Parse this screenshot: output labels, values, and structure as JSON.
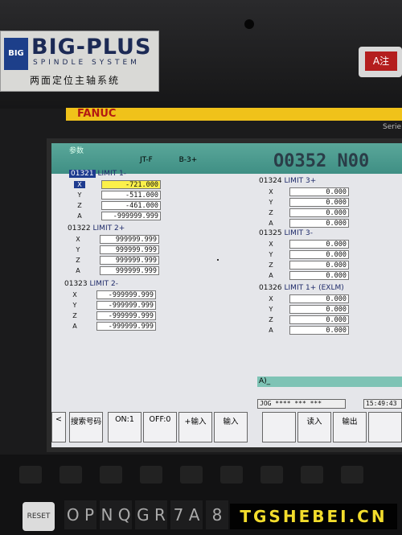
{
  "bezel": {
    "brand_title": "BIG-PLUS",
    "brand_subtitle": "SPINDLE SYSTEM",
    "brand_chinese": "两面定位主轴系统",
    "cnc_brand": "FANUC",
    "series_label": "Serie",
    "warning_label": "A注"
  },
  "screen": {
    "header_label": "参数",
    "program_label": "JT-F",
    "program_suffix": "B-3+",
    "program_number": "O0352 N00",
    "params_left": [
      {
        "id": "01321",
        "name": "LIMIT 1-",
        "rows": [
          {
            "axis": "X",
            "value": "-721.000"
          },
          {
            "axis": "Y",
            "value": "-511.000"
          },
          {
            "axis": "Z",
            "value": "-461.000"
          },
          {
            "axis": "A",
            "value": "-999999.999"
          }
        ]
      },
      {
        "id": "01322",
        "name": "LIMIT 2+",
        "rows": [
          {
            "axis": "X",
            "value": "999999.999"
          },
          {
            "axis": "Y",
            "value": "999999.999"
          },
          {
            "axis": "Z",
            "value": "999999.999"
          },
          {
            "axis": "A",
            "value": "999999.999"
          }
        ]
      },
      {
        "id": "01323",
        "name": "LIMIT 2-",
        "rows": [
          {
            "axis": "X",
            "value": "-999999.999"
          },
          {
            "axis": "Y",
            "value": "-999999.999"
          },
          {
            "axis": "Z",
            "value": "-999999.999"
          },
          {
            "axis": "A",
            "value": "-999999.999"
          }
        ]
      }
    ],
    "params_right": [
      {
        "id": "01324",
        "name": "LIMIT 3+",
        "rows": [
          {
            "axis": "X",
            "value": "0.000"
          },
          {
            "axis": "Y",
            "value": "0.000"
          },
          {
            "axis": "Z",
            "value": "0.000"
          },
          {
            "axis": "A",
            "value": "0.000"
          }
        ]
      },
      {
        "id": "01325",
        "name": "LIMIT 3-",
        "rows": [
          {
            "axis": "X",
            "value": "0.000"
          },
          {
            "axis": "Y",
            "value": "0.000"
          },
          {
            "axis": "Z",
            "value": "0.000"
          },
          {
            "axis": "A",
            "value": "0.000"
          }
        ]
      },
      {
        "id": "01326",
        "name": "LIMIT 1+ (EXLM)",
        "rows": [
          {
            "axis": "X",
            "value": "0.000"
          },
          {
            "axis": "Y",
            "value": "0.000"
          },
          {
            "axis": "Z",
            "value": "0.000"
          },
          {
            "axis": "A",
            "value": "0.000"
          }
        ]
      }
    ],
    "input_prompt": "A)_",
    "mode": "JOG **** *** ***",
    "time": "15:49:43",
    "softkeys": [
      "<",
      "搜索号码",
      "ON:1",
      "OFF:0",
      "+输入",
      "输入",
      "",
      "读入",
      "输出",
      ""
    ]
  },
  "keyboard": {
    "keys": [
      "O P",
      "N Q",
      "G R",
      "7 A",
      "8"
    ],
    "reset_label": "RESET"
  },
  "watermark": "TGSHEBEI.CN"
}
